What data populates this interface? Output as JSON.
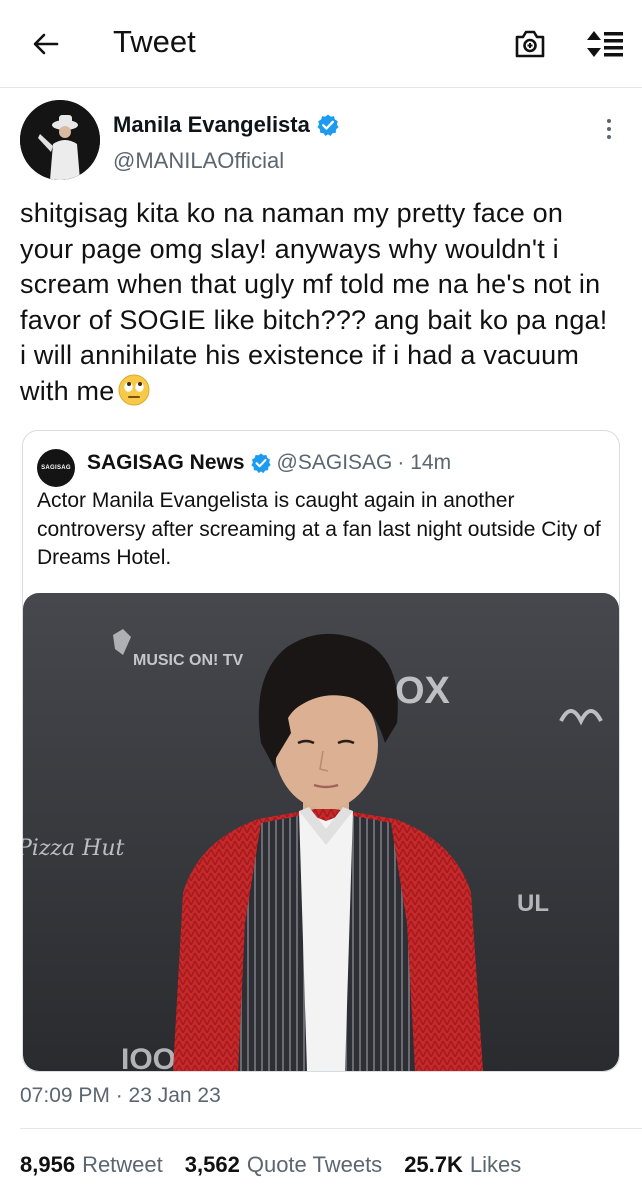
{
  "header": {
    "title": "Tweet",
    "back_icon": "arrow-left-icon",
    "camera_icon": "camera-icon",
    "sort_icon": "sort-icon"
  },
  "tweet": {
    "display_name": "Manila Evangelista",
    "handle": "@MANILAOfficial",
    "verified": true,
    "text": "shitgisag kita ko na naman my pretty face on your page omg slay! anyways why wouldn't i scream when that ugly mf told me na he's not in favor of SOGIE like bitch??? ang bait ko pa nga! i will annihilate his existence if i had a vacuum with me",
    "emoji": "eye-roll-emoji",
    "timestamp": "07:09 PM · 23 Jan 23"
  },
  "quoted_tweet": {
    "avatar_text": "SAGISAG",
    "display_name": "SAGISAG News",
    "verified": true,
    "handle": "@SAGISAG",
    "time": "· 14m",
    "text": "Actor Manila Evangelista is caught again in another controversy after screaming at a fan last night outside City of Dreams Hotel.",
    "image_backdrop_texts": [
      "MUSIC ON! TV",
      "OX",
      "Pizza Hut",
      "UL",
      "IOO"
    ]
  },
  "stats": [
    {
      "count": "8,956",
      "label": "Retweet"
    },
    {
      "count": "3,562",
      "label": "Quote Tweets"
    },
    {
      "count": "25.7K",
      "label": "Likes"
    }
  ],
  "colors": {
    "verified_blue": "#1d9bf0",
    "secondary_text": "#5b6670",
    "divider": "#e6e6e6",
    "cardigan_red": "#c8282a"
  }
}
